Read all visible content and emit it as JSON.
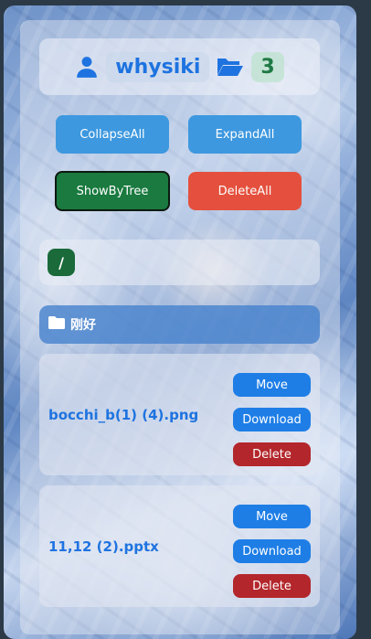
{
  "header": {
    "username": "whysiki",
    "file_count": "3",
    "user_icon": "user-icon",
    "folder_icon": "folder-open-icon"
  },
  "toolbar": {
    "collapse_all": "CollapseAll",
    "expand_all": "ExpandAll",
    "show_by_tree": "ShowByTree",
    "delete_all": "DeleteAll"
  },
  "path": {
    "current": "/"
  },
  "folder": {
    "name": "刚好",
    "icon": "folder-icon"
  },
  "files": [
    {
      "name": "bocchi_b(1) (4).png",
      "move_label": "Move",
      "download_label": "Download",
      "delete_label": "Delete"
    },
    {
      "name": "11,12 (2).pptx",
      "move_label": "Move",
      "download_label": "Download",
      "delete_label": "Delete"
    }
  ],
  "colors": {
    "accent": "#1e73e0",
    "danger": "#e4503d",
    "success": "#1a7a3f"
  }
}
